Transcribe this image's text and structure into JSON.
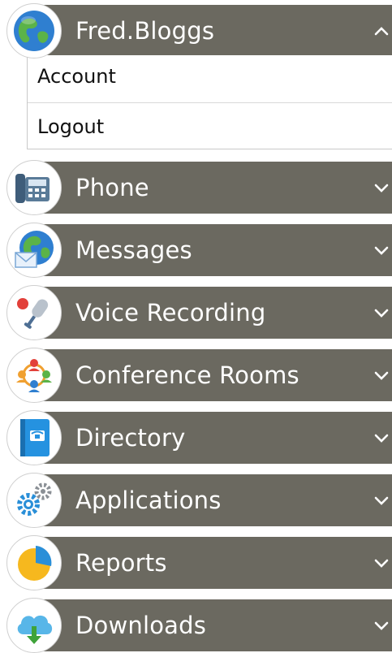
{
  "user": {
    "name": "Fred.Bloggs",
    "expanded": true
  },
  "user_menu": [
    {
      "label": "Account"
    },
    {
      "label": "Logout"
    }
  ],
  "menu": [
    {
      "label": "Phone",
      "icon": "desk-phone-icon"
    },
    {
      "label": "Messages",
      "icon": "messages-globe-icon"
    },
    {
      "label": "Voice Recording",
      "icon": "microphone-icon"
    },
    {
      "label": "Conference Rooms",
      "icon": "people-group-icon"
    },
    {
      "label": "Directory",
      "icon": "phone-book-icon"
    },
    {
      "label": "Applications",
      "icon": "gears-icon"
    },
    {
      "label": "Reports",
      "icon": "pie-chart-icon"
    },
    {
      "label": "Downloads",
      "icon": "cloud-download-icon"
    }
  ],
  "colors": {
    "bar": "#6b6960",
    "bar_text": "#ffffff"
  }
}
